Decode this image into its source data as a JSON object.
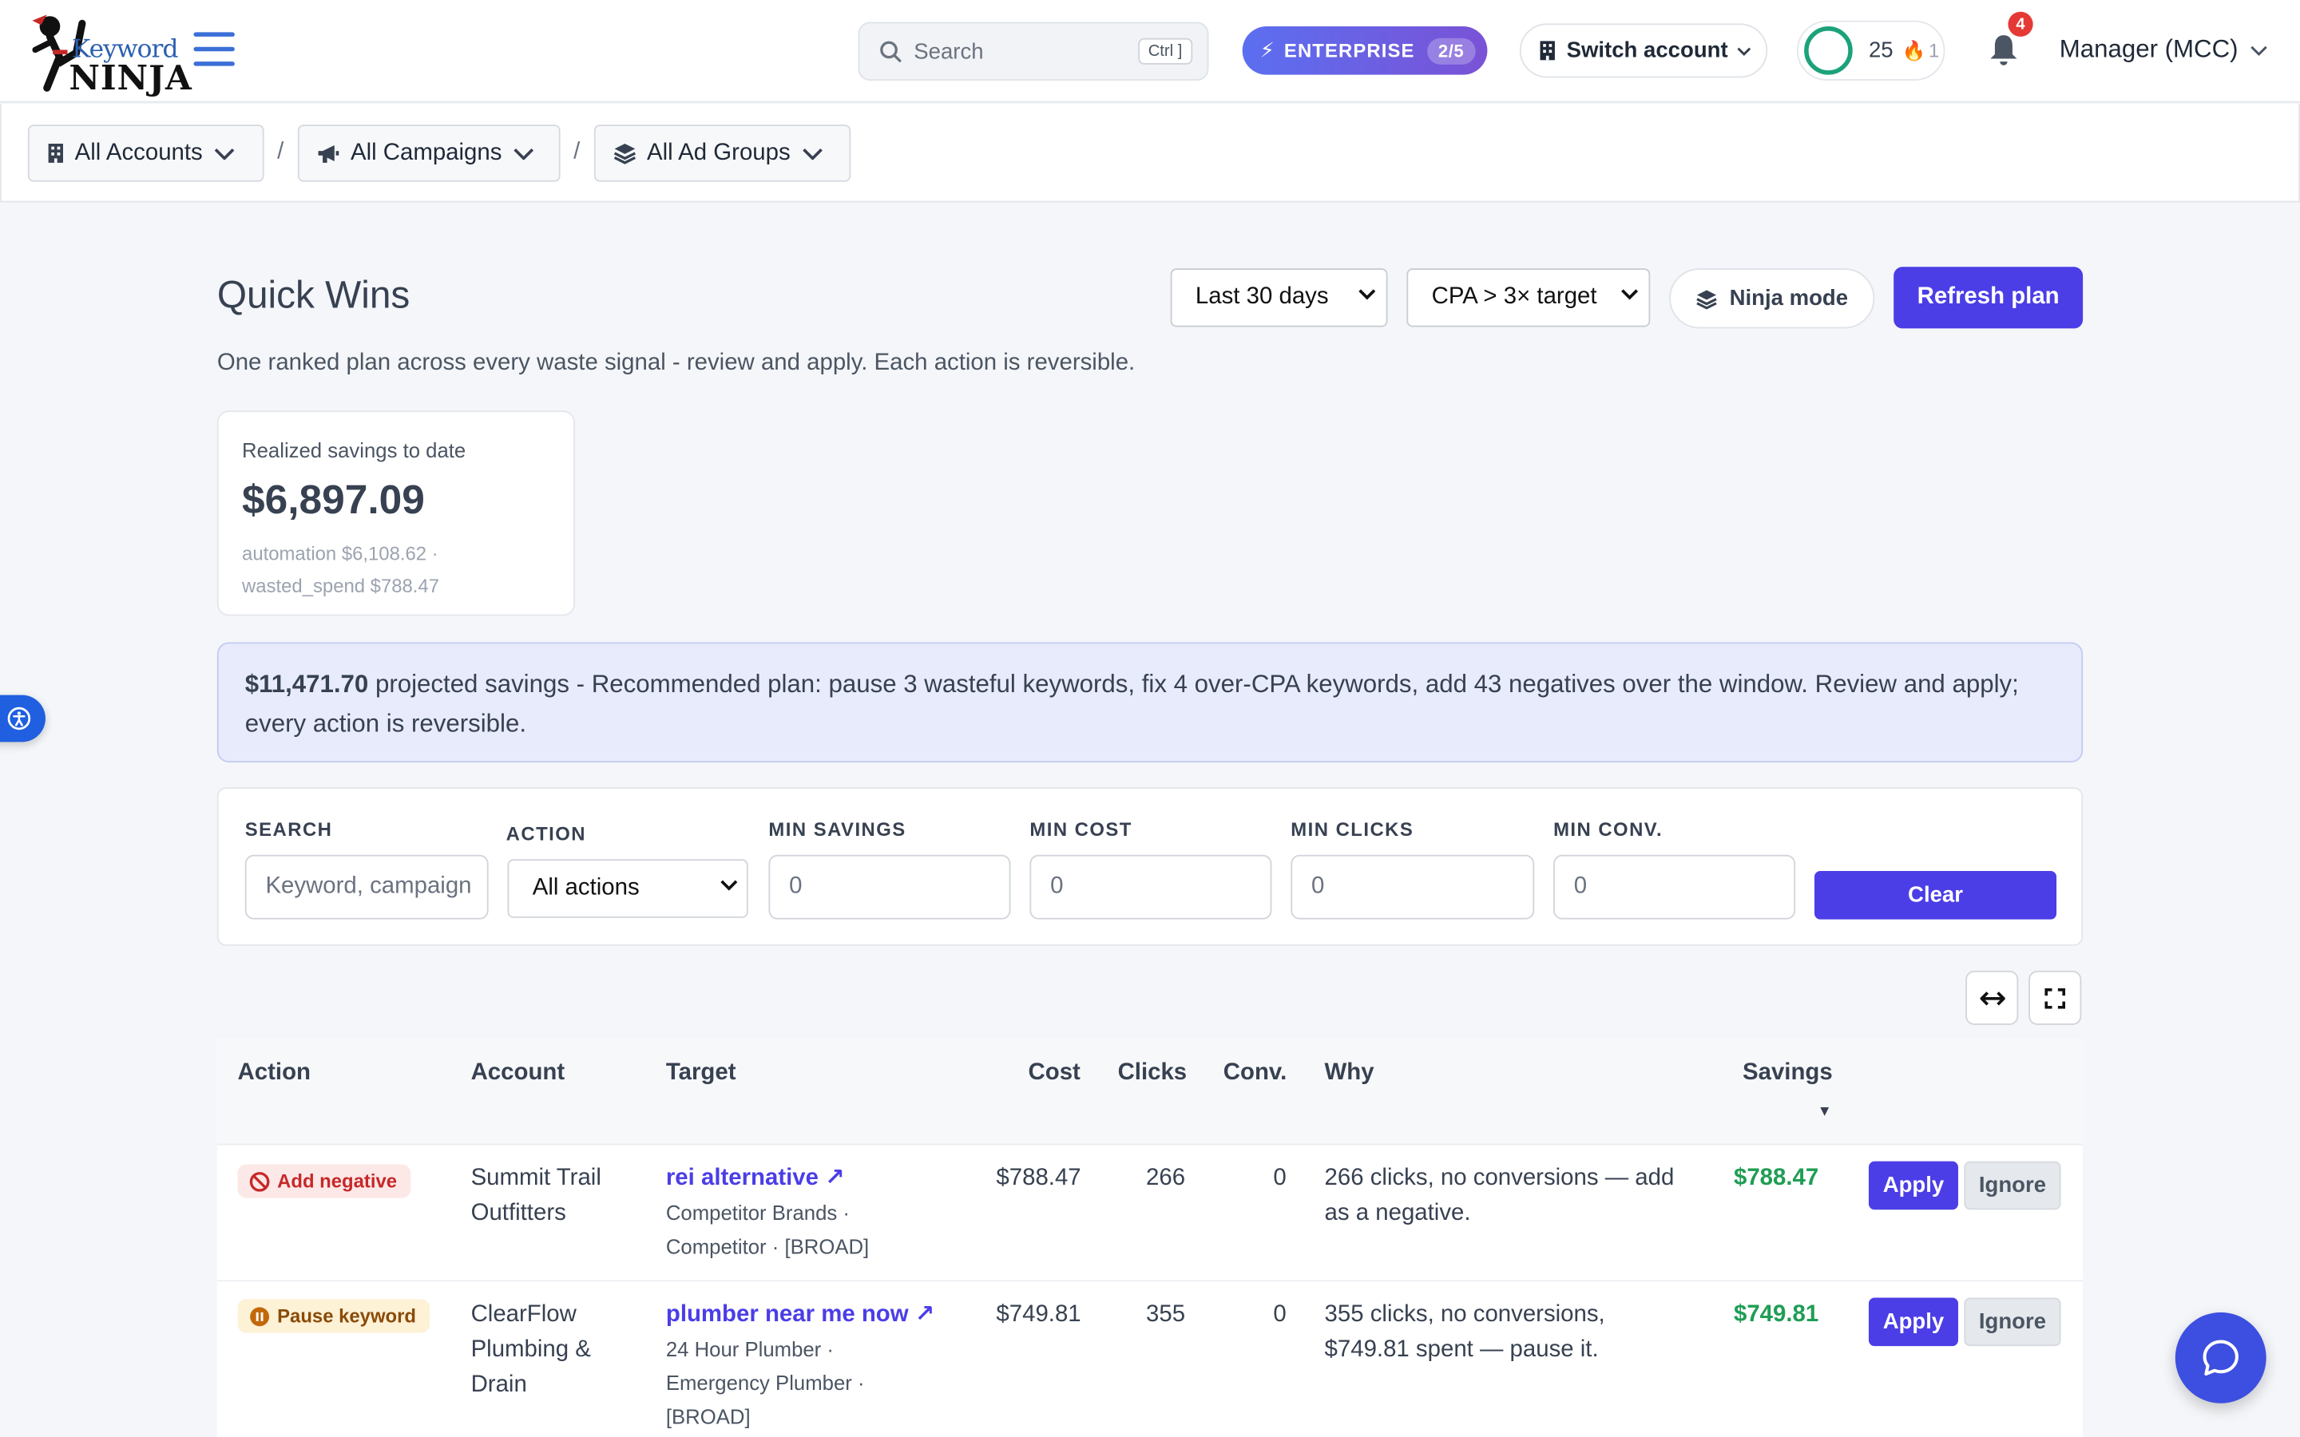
{
  "app": {
    "logo_top": "Keyword",
    "logo_bottom": "NINJA"
  },
  "header": {
    "search_placeholder": "Search",
    "search_shortcut": "Ctrl ]",
    "plan_label": "ENTERPRISE",
    "plan_count": "2/5",
    "switch_account_label": "Switch account",
    "progress_count": "25",
    "streak_count": "1",
    "notification_count": "4",
    "account_menu_label": "Manager (MCC)"
  },
  "breadcrumb": {
    "accounts": "All Accounts",
    "campaigns": "All Campaigns",
    "ad_groups": "All Ad Groups",
    "separator": "/"
  },
  "page": {
    "title": "Quick Wins",
    "date_range": "Last 30 days",
    "rule": "CPA > 3× target",
    "ninja_mode_label": "Ninja mode",
    "refresh_label": "Refresh plan",
    "subtitle": "One ranked plan across every waste signal - review and apply. Each action is reversible."
  },
  "savings_card": {
    "label": "Realized savings to date",
    "value": "$6,897.09",
    "breakdown_line1": "automation $6,108.62 ·",
    "breakdown_line2": "wasted_spend $788.47"
  },
  "banner": {
    "amount": "$11,471.70",
    "text": " projected savings - Recommended plan: pause 3 wasteful keywords, fix 4 over-CPA keywords, add 43 negatives over the window. Review and apply; every action is reversible."
  },
  "filters": {
    "search_label": "SEARCH",
    "search_placeholder": "Keyword, campaign",
    "action_label": "ACTION",
    "action_value": "All actions",
    "min_savings_label": "MIN SAVINGS",
    "min_savings_value": "0",
    "min_cost_label": "MIN COST",
    "min_cost_value": "0",
    "min_clicks_label": "MIN CLICKS",
    "min_clicks_value": "0",
    "min_conv_label": "MIN CONV.",
    "min_conv_value": "0",
    "clear_label": "Clear"
  },
  "table": {
    "columns": {
      "action": "Action",
      "account": "Account",
      "target": "Target",
      "cost": "Cost",
      "clicks": "Clicks",
      "conv": "Conv.",
      "why": "Why",
      "savings": "Savings",
      "sort_indicator": "▼"
    },
    "rows": [
      {
        "action": "Add negative",
        "action_type": "negative",
        "account_line1": "Summit Trail",
        "account_line2": "Outfitters",
        "account_line3": "",
        "target": "rei alternative ↗",
        "target_sub1": "Competitor Brands ·",
        "target_sub2": "Competitor · [BROAD]",
        "target_sub3": "",
        "cost": "$788.47",
        "clicks": "266",
        "conv": "0",
        "why_line1": "266 clicks, no conversions — add",
        "why_line2": "as a negative.",
        "savings": "$788.47",
        "apply": "Apply",
        "ignore": "Ignore"
      },
      {
        "action": "Pause keyword",
        "action_type": "pause",
        "account_line1": "ClearFlow",
        "account_line2": "Plumbing &",
        "account_line3": "Drain",
        "target": "plumber near me now ↗",
        "target_sub1": "24 Hour Plumber ·",
        "target_sub2": "Emergency Plumber ·",
        "target_sub3": "[BROAD]",
        "cost": "$749.81",
        "clicks": "355",
        "conv": "0",
        "why_line1": "355 clicks, no conversions,",
        "why_line2": "$749.81 spent — pause it.",
        "savings": "$749.81",
        "apply": "Apply",
        "ignore": "Ignore"
      }
    ]
  },
  "colors": {
    "accent": "#4b3ee6",
    "savings_green": "#1f9d55",
    "negative_red": "#c62828",
    "pause_amber": "#8a4b08"
  }
}
